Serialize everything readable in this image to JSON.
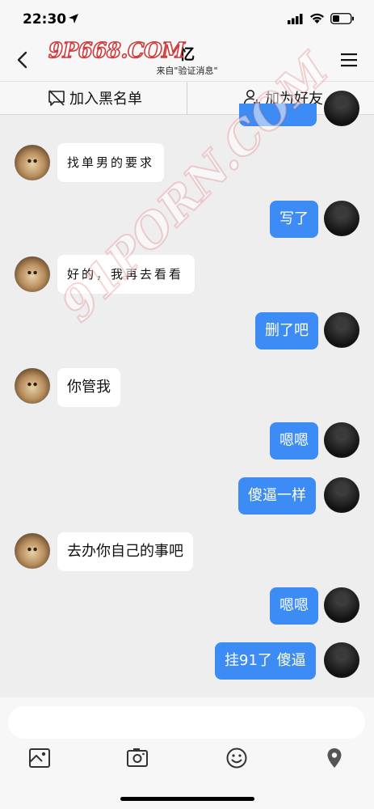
{
  "status_bar": {
    "time": "22:30"
  },
  "header": {
    "watermark_top": "9P668.COM",
    "title": "忆",
    "subtitle": "来自\"验证消息\"",
    "icons": {
      "back": "chevron-left-icon",
      "menu": "hamburger-menu-icon"
    }
  },
  "actions": {
    "blacklist_label": "加入黑名单",
    "add_friend_label": "加为好友"
  },
  "watermark_diagonal": "91PORN.COM",
  "messages": [
    {
      "side": "right",
      "text": "",
      "partial": true
    },
    {
      "side": "left",
      "text": "找单男的要求"
    },
    {
      "side": "right",
      "text": "写了"
    },
    {
      "side": "left",
      "text": "好的，我再去看看"
    },
    {
      "side": "right",
      "text": "删了吧"
    },
    {
      "side": "left",
      "text": "你管我"
    },
    {
      "side": "right",
      "text": "嗯嗯"
    },
    {
      "side": "right",
      "text": "傻逼一样"
    },
    {
      "side": "left",
      "text": "去办你自己的事吧"
    },
    {
      "side": "right",
      "text": "嗯嗯"
    },
    {
      "side": "right",
      "text": "挂91了 傻逼"
    }
  ],
  "composer": {
    "input_value": "",
    "toolbar_icons": [
      "photo-icon",
      "camera-icon",
      "emoji-icon",
      "location-pin-icon"
    ]
  },
  "colors": {
    "bubble_right": "#3d8cf5",
    "bubble_left": "#ffffff",
    "background": "#eeeeee",
    "watermark": "#d03a3a"
  }
}
